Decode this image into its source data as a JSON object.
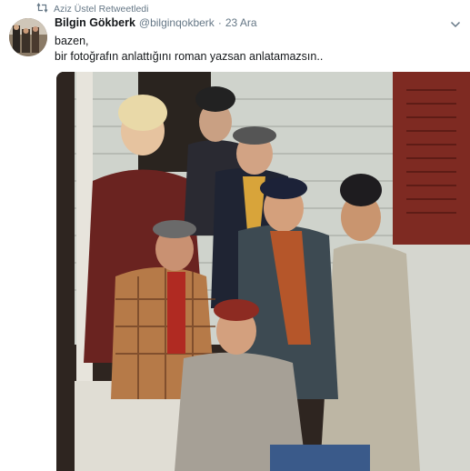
{
  "retweet": {
    "icon": "retweet-icon",
    "label": "Aziz Üstel Retweetledi"
  },
  "tweet": {
    "author_name": "Bilgin Gökberk",
    "author_handle": "@bilginqokberk",
    "separator": "·",
    "date": "23 Ara",
    "text_line1": "bazen,",
    "text_line2": "bir fotoğrafın anlattığını roman yazsan anlatamazsın..",
    "menu_icon": "chevron-down-icon",
    "media_icon": "photo"
  },
  "colors": {
    "text_primary": "#14171a",
    "text_secondary": "#657786"
  }
}
